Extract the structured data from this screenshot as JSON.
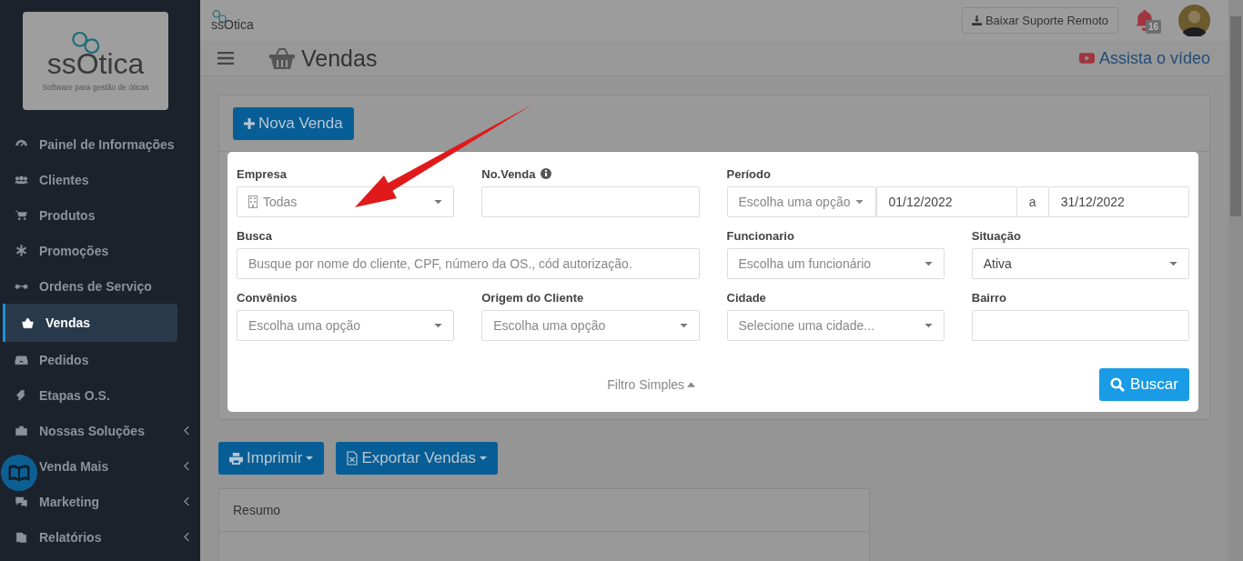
{
  "sidebar": {
    "logo": {
      "name": "ssOtica",
      "tagline": "Software para gestão de óticas"
    },
    "items": [
      {
        "label": "Painel de Informações",
        "selected": false,
        "expandable": false
      },
      {
        "label": "Clientes",
        "selected": false,
        "expandable": false
      },
      {
        "label": "Produtos",
        "selected": false,
        "expandable": false
      },
      {
        "label": "Promoções",
        "selected": false,
        "expandable": false
      },
      {
        "label": "Ordens de Serviço",
        "selected": false,
        "expandable": false
      },
      {
        "label": "Vendas",
        "selected": true,
        "expandable": false
      },
      {
        "label": "Pedidos",
        "selected": false,
        "expandable": false
      },
      {
        "label": "Etapas O.S.",
        "selected": false,
        "expandable": false
      },
      {
        "label": "Nossas Soluções",
        "selected": false,
        "expandable": true
      },
      {
        "label": "Venda Mais",
        "selected": false,
        "expandable": true
      },
      {
        "label": "Marketing",
        "selected": false,
        "expandable": true
      },
      {
        "label": "Relatórios",
        "selected": false,
        "expandable": true
      }
    ]
  },
  "topbar": {
    "logo": "ssOtica",
    "support_button": "Baixar Suporte Remoto",
    "notifications": "16"
  },
  "header": {
    "title": "Vendas",
    "video_link": "Assista o vídeo"
  },
  "new_button": "Nova Venda",
  "filters": [
    {
      "kind": "company-select",
      "label": "Empresa",
      "placeholder": "Todas"
    },
    {
      "kind": "input",
      "label": "No.Venda",
      "info": true
    },
    {
      "kind": "period",
      "label": "Período",
      "placeholder": "Escolha uma opção",
      "from": "01/12/2022",
      "separator": "a",
      "to": "31/12/2022"
    },
    {
      "kind": "input",
      "label": "Busca",
      "placeholder": "Busque por nome do cliente, CPF, número da OS., cód autorização.",
      "wide": true
    },
    {
      "kind": "select",
      "label": "Funcionario",
      "placeholder": "Escolha um funcionário"
    },
    {
      "kind": "select",
      "label": "Situação",
      "value": "Ativa"
    },
    {
      "kind": "select",
      "label": "Convênios",
      "placeholder": "Escolha uma opção"
    },
    {
      "kind": "select",
      "label": "Origem do Cliente",
      "placeholder": "Escolha uma opção"
    },
    {
      "kind": "select",
      "label": "Cidade",
      "placeholder": "Selecione uma cidade..."
    },
    {
      "kind": "input",
      "label": "Bairro"
    }
  ],
  "filter_toggle": "Filtro Simples",
  "search_button": "Buscar",
  "actions": [
    {
      "label": "Imprimir"
    },
    {
      "label": "Exportar Vendas"
    }
  ],
  "summary": {
    "title": "Resumo"
  }
}
